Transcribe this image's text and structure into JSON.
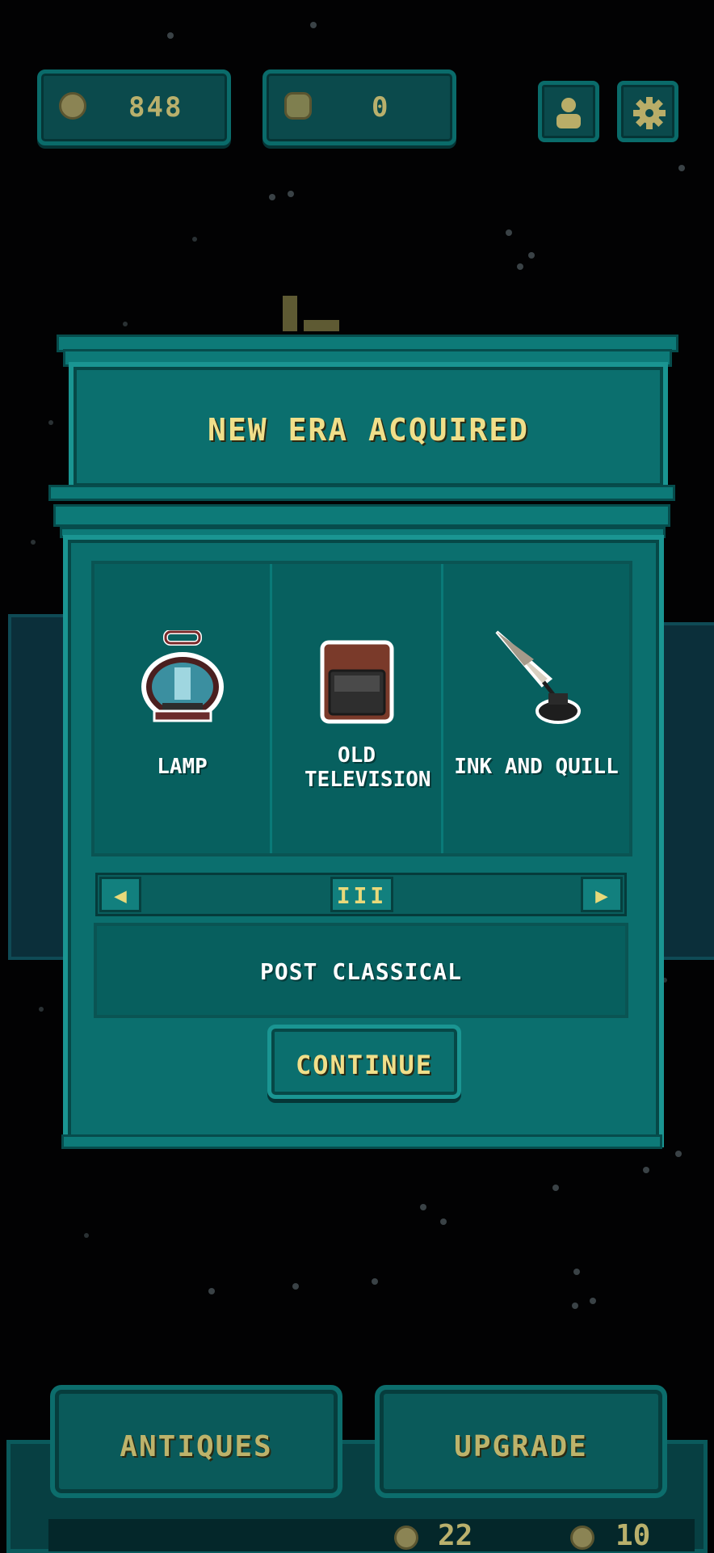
{
  "hud": {
    "coins": "848",
    "gems": "0",
    "profile_icon": "person-icon",
    "settings_icon": "gear-icon"
  },
  "modal": {
    "title": "NEW ERA ACQUIRED",
    "items": [
      {
        "label": "LAMP",
        "icon": "lamp-icon"
      },
      {
        "label": "OLD TELEVISION",
        "icon": "television-icon"
      },
      {
        "label": "INK AND QUILL",
        "icon": "quill-icon"
      }
    ],
    "scroll_left": "◀",
    "scroll_right": "▶",
    "scroll_thumb": "III",
    "era_name": "POST CLASSICAL",
    "continue_label": "CONTINUE"
  },
  "bottom": {
    "antiques_label": "ANTIQUES",
    "upgrade_label": "UPGRADE",
    "count_a": "22",
    "count_b": "10"
  },
  "colors": {
    "accent_teal": "#0b6f6e",
    "title_yellow": "#f0df8a",
    "background": "#020203"
  }
}
